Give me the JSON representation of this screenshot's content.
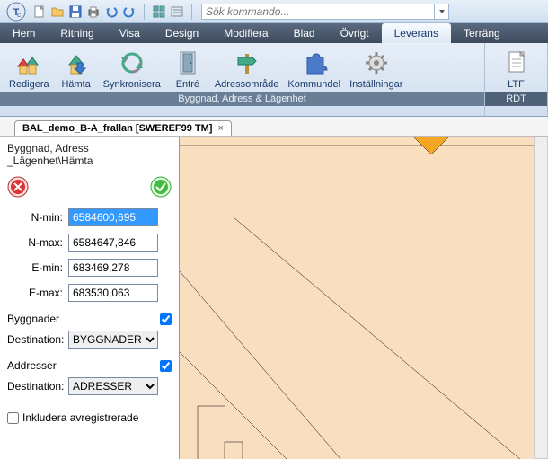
{
  "search": {
    "placeholder": "Sök kommando..."
  },
  "menu": {
    "items": [
      "Hem",
      "Ritning",
      "Visa",
      "Design",
      "Modifiera",
      "Blad",
      "Övrigt",
      "Leverans",
      "Terräng"
    ],
    "active_index": 7
  },
  "ribbon": {
    "group1": {
      "title": "Byggnad, Adress & Lägenhet",
      "buttons": [
        "Redigera",
        "Hämta",
        "Synkronisera",
        "Entré",
        "Adressområde",
        "Kommundel",
        "Inställningar"
      ]
    },
    "group2": {
      "title": "RDT",
      "buttons": [
        "LTF"
      ]
    }
  },
  "tab": {
    "label": "BAL_demo_B-A_frallan [SWEREF99 TM]"
  },
  "side": {
    "breadcrumb": "Byggnad, Adress _Lägenhet\\Hämta",
    "nmin_label": "N-min:",
    "nmin_value": "6584600,695",
    "nmax_label": "N-max:",
    "nmax_value": "6584647,846",
    "emin_label": "E-min:",
    "emin_value": "683469,278",
    "emax_label": "E-max:",
    "emax_value": "683530,063",
    "byggnader_label": "Byggnader",
    "dest1_label": "Destination:",
    "dest1_value": "BYGGNADER",
    "addresser_label": "Addresser",
    "dest2_label": "Destination:",
    "dest2_value": "ADRESSER",
    "include_label": "Inkludera avregistrerade"
  }
}
